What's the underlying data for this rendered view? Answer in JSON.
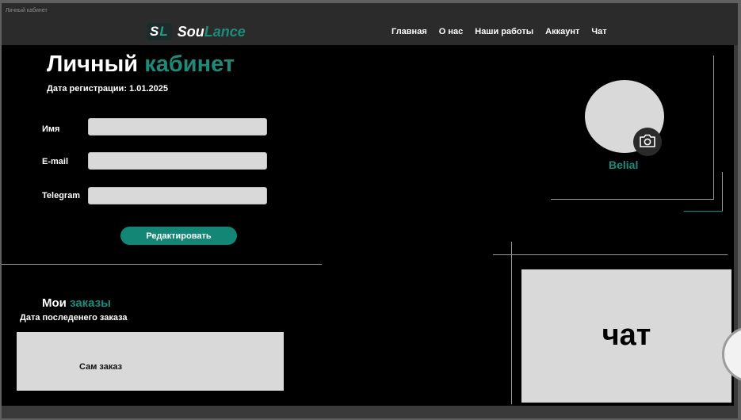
{
  "window": {
    "title": "Личный кабинет"
  },
  "logo": {
    "mark_first": "S",
    "mark_second": "L",
    "name_first": "Sou",
    "name_second": "Lance"
  },
  "nav": {
    "items": [
      {
        "label": "Главная"
      },
      {
        "label": "О нас"
      },
      {
        "label": "Наши работы"
      },
      {
        "label": "Аккаунт"
      },
      {
        "label": "Чат"
      }
    ]
  },
  "profile": {
    "title_first": "Личный",
    "title_second": "кабинет",
    "registration_date": "Дата регистрации: 1.01.2025",
    "fields": [
      {
        "label": "Имя",
        "value": "",
        "placeholder": ""
      },
      {
        "label": "E-mail",
        "value": "",
        "placeholder": ""
      },
      {
        "label": "Telegram",
        "value": "",
        "placeholder": ""
      }
    ],
    "edit_button": "Редактировать"
  },
  "user": {
    "name": "Belial",
    "camera_icon": "camera-icon"
  },
  "orders": {
    "title_first": "Мои",
    "title_second": "заказы",
    "last_order_label": "Дата последенего заказа",
    "order_card_label": "Сам заказ"
  },
  "chat": {
    "label": "чат"
  },
  "colors": {
    "accent": "#1e8b7a",
    "button": "#138676",
    "background": "#000000",
    "navbar": "#2b2b2b",
    "panel": "#d9d9d9"
  }
}
